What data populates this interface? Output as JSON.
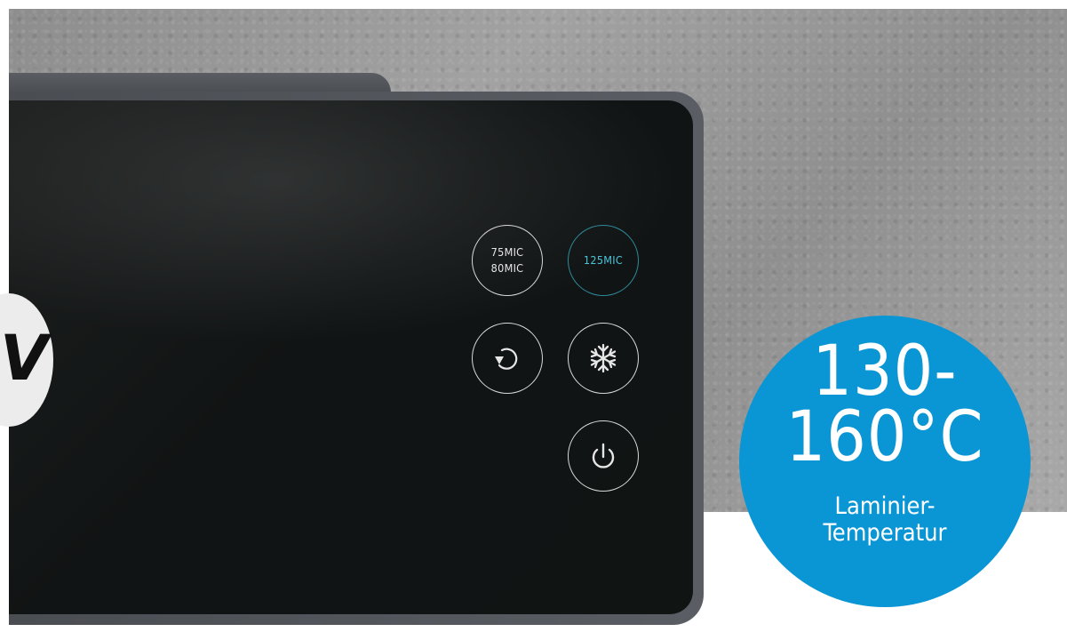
{
  "panel_buttons": {
    "thickness_75_80": [
      "75MIC",
      "80MIC"
    ],
    "thickness_125": "125MIC",
    "reverse_icon": "reverse-arrow-icon",
    "cool_icon": "snowflake-icon",
    "power_icon": "power-icon"
  },
  "badge": {
    "temperature_line1": "130-",
    "temperature_line2": "160°C",
    "label_line1": "Laminier-",
    "label_line2": "Temperatur",
    "color": "#0a96d4"
  },
  "colors": {
    "panel": "#111414",
    "active_button": "#4ec4da",
    "wall": "#9a9a9a"
  }
}
